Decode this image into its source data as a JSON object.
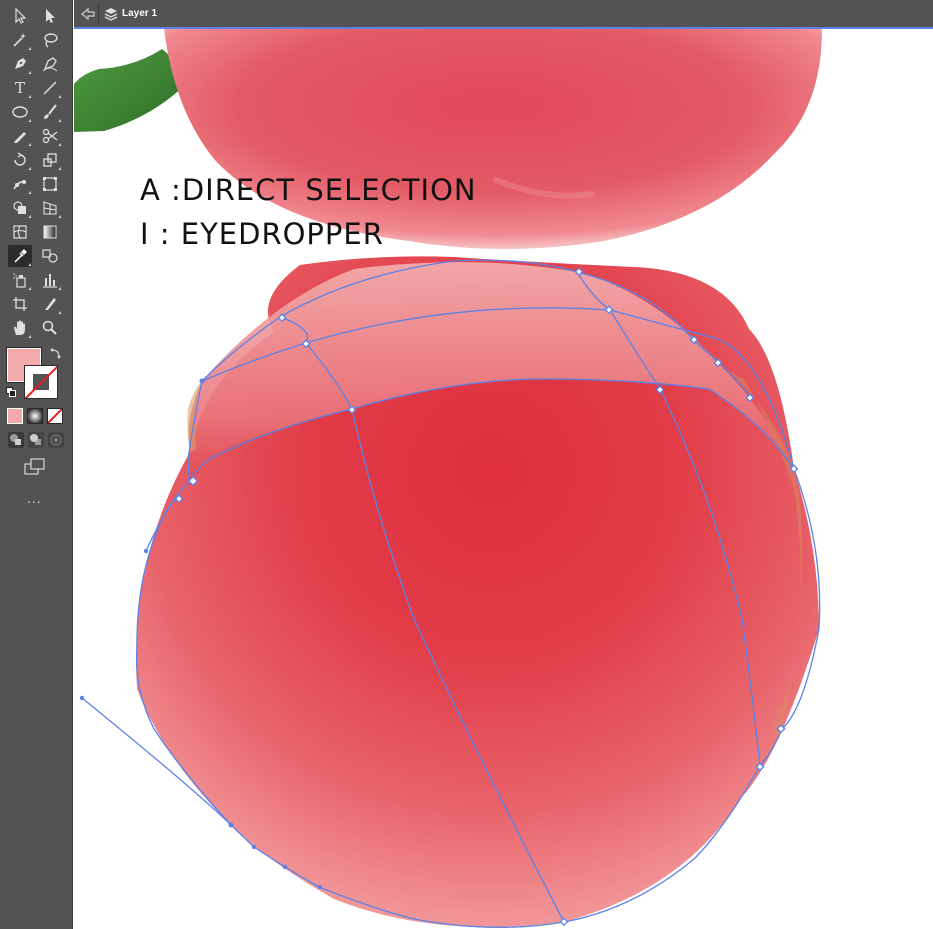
{
  "layer_bar": {
    "layer_name": "Layer 1"
  },
  "toolbar": {
    "tools": [
      "selection-tool",
      "direct-selection-tool",
      "magic-wand-tool",
      "lasso-tool",
      "pen-tool",
      "curvature-tool",
      "type-tool",
      "line-segment-tool",
      "ellipse-tool",
      "paintbrush-tool",
      "pencil-tool",
      "scissors-tool",
      "rotate-tool",
      "scale-tool",
      "puppet-warp-tool",
      "free-transform-tool",
      "shape-builder-tool",
      "perspective-grid-tool",
      "mesh-tool",
      "gradient-tool",
      "eyedropper-tool",
      "blend-tool",
      "symbol-sprayer-tool",
      "column-graph-tool",
      "artboard-tool",
      "slice-tool",
      "hand-tool",
      "zoom-tool"
    ],
    "active_tool": "eyedropper-tool",
    "fill_color": "#f4a9ab",
    "stroke": "none",
    "type_glyph": "T",
    "more_label": "..."
  },
  "canvas": {
    "shortcut_lines": [
      "A :DIRECT SELECTION",
      "I : EYEDROPPER"
    ]
  },
  "colors": {
    "toolbar_bg": "#535353",
    "selection_accent": "#5b82e8",
    "mesh_core": "#e0303a",
    "mesh_edge": "#f4a9ab",
    "photo_red": "#e25662"
  }
}
